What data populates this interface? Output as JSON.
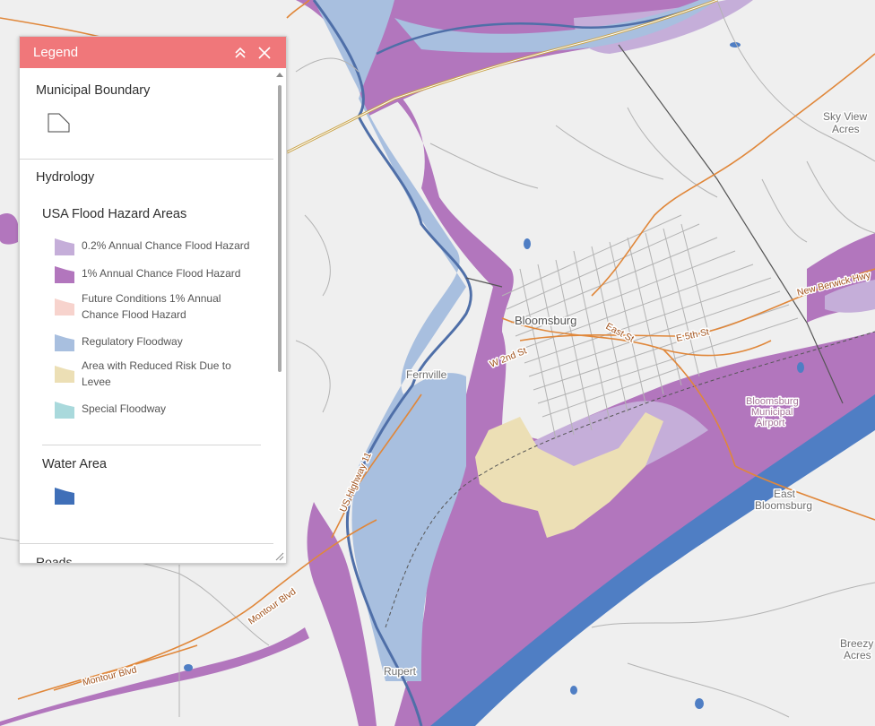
{
  "colors": {
    "header": "#f0777a",
    "flood_02": "#c5aed9",
    "flood_1": "#b276bd",
    "future": "#f7d3cd",
    "floodway": "#a8bfdf",
    "levee": "#ecdfb5",
    "special": "#a9d9dc",
    "water": "#4f7ec4"
  },
  "legend": {
    "title": "Legend",
    "collapse_icon": "double-chevron-up-icon",
    "close_icon": "close-icon",
    "municipal": {
      "title": "Municipal Boundary"
    },
    "hydrology": {
      "title": "Hydrology",
      "flood": {
        "title": "USA Flood Hazard Areas",
        "items": [
          {
            "label": "0.2% Annual Chance Flood Hazard"
          },
          {
            "label": "1% Annual Chance Flood Hazard"
          },
          {
            "label": "Future Conditions 1% Annual Chance Flood Hazard"
          },
          {
            "label": "Regulatory Floodway"
          },
          {
            "label": "Area with Reduced Risk Due to Levee"
          },
          {
            "label": "Special Floodway"
          }
        ]
      },
      "water": {
        "title": "Water Area"
      }
    },
    "next_section_partial": "Roads"
  },
  "map": {
    "labels": {
      "bloomsburg": "Bloomsburg",
      "fernville": "Fernville",
      "east_bloomsburg_1": "East",
      "east_bloomsburg_2": "Bloomsburg",
      "sky_view_1": "Sky View",
      "sky_view_2": "Acres",
      "rupert": "Rupert",
      "breezy_1": "Breezy",
      "breezy_2": "Acres",
      "airport_1": "Bloomsburg",
      "airport_2": "Municipal",
      "airport_3": "Airport",
      "w2nd": "W 2nd St",
      "east_st": "East St",
      "fifth": "E 5th St",
      "new_berwick": "New Berwick Hwy",
      "us11": "US Highway 11",
      "montour1": "Montour Blvd",
      "montour2": "Montour Blvd"
    }
  }
}
